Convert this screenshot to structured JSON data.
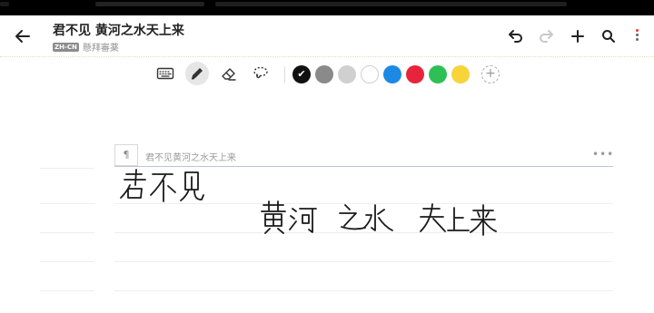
{
  "header": {
    "title": "君不见 黄河之水天上来",
    "language_badge": "ZH-CN",
    "subtitle": "懸拜審薬"
  },
  "toolbar": {
    "tools": [
      {
        "icon": "keyboard-icon",
        "selected": false
      },
      {
        "icon": "pen-icon",
        "selected": true
      },
      {
        "icon": "eraser-icon",
        "selected": false
      },
      {
        "icon": "lasso-icon",
        "selected": false
      }
    ],
    "colors": [
      {
        "name": "black",
        "hex": "#111111",
        "selected": true
      },
      {
        "name": "dark-gray",
        "hex": "#8a8a8a",
        "selected": false
      },
      {
        "name": "light-gray",
        "hex": "#d0d0d0",
        "selected": false
      },
      {
        "name": "white",
        "hex": "#ffffff",
        "selected": false
      },
      {
        "name": "blue",
        "hex": "#1e88e5",
        "selected": false
      },
      {
        "name": "red",
        "hex": "#e8243c",
        "selected": false
      },
      {
        "name": "green",
        "hex": "#2ec055",
        "selected": false
      },
      {
        "name": "yellow",
        "hex": "#f6d43a",
        "selected": false
      }
    ],
    "add_color_symbol": "+"
  },
  "note": {
    "paragraph_symbol": "¶",
    "recognized_text": "君不见黄河之水天上来",
    "more_symbol": "•••",
    "handwriting": [
      "君不见",
      "黄河之水 天上来"
    ]
  },
  "colors": {
    "accent": "#1e88e5",
    "ruled_line": "#eeeeee",
    "active_line": "#b9c6db",
    "toolbar_border": "#f0e4c0"
  }
}
